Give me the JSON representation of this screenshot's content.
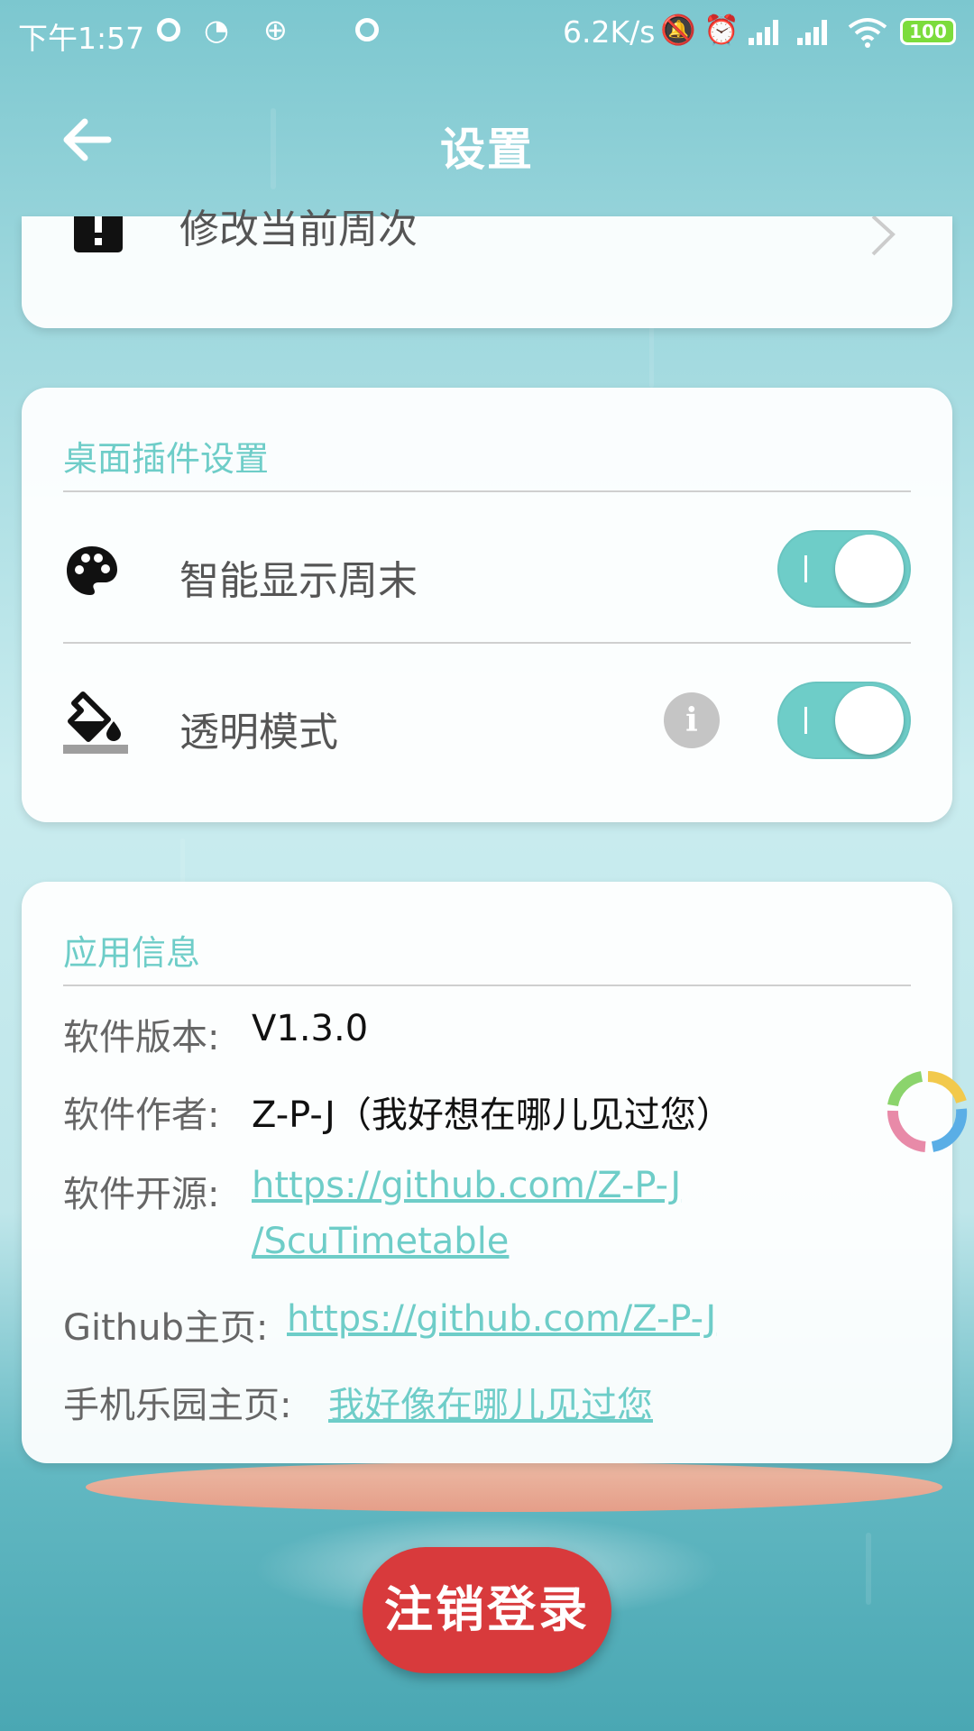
{
  "status_bar": {
    "time": "下午1:57",
    "net_speed": "6.2K/s",
    "battery": "100",
    "icons": [
      "circle-icon",
      "cast-icon",
      "vpn-icon",
      "circle-icon",
      "mute-icon",
      "alarm-icon",
      "signal-icon",
      "signal-icon",
      "wifi-icon",
      "battery-icon"
    ]
  },
  "header": {
    "title": "设置",
    "back_icon": "arrow-left-icon"
  },
  "top_card": {
    "label": "修改当前周次",
    "icon": "alert-icon",
    "chevron_icon": "chevron-right-icon"
  },
  "widget_section": {
    "title": "桌面插件设置",
    "rows": [
      {
        "label": "智能显示周末",
        "icon": "palette-icon",
        "enabled": true
      },
      {
        "label": "透明模式",
        "icon": "paint-bucket-icon",
        "enabled": true,
        "info_icon": "info-icon",
        "info_glyph": "i"
      }
    ]
  },
  "app_info": {
    "title": "应用信息",
    "version_label": "软件版本:",
    "version_value": "V1.3.0",
    "author_label": "软件作者:",
    "author_value": "Z-P-J（我好想在哪儿见过您）",
    "source_label": "软件开源:",
    "source_link_line1": "https://github.com/Z-P-J",
    "source_link_line2": "/ScuTimetable",
    "github_label": "Github主页:",
    "github_link": "https://github.com/Z-P-J",
    "shouji_label": "手机乐园主页:",
    "shouji_link": "我好像在哪儿见过您"
  },
  "logout": {
    "label": "注销登录"
  },
  "colors": {
    "accent": "#6ecdc8",
    "logout": "#d83a3c",
    "header_text": "#ffffff"
  }
}
